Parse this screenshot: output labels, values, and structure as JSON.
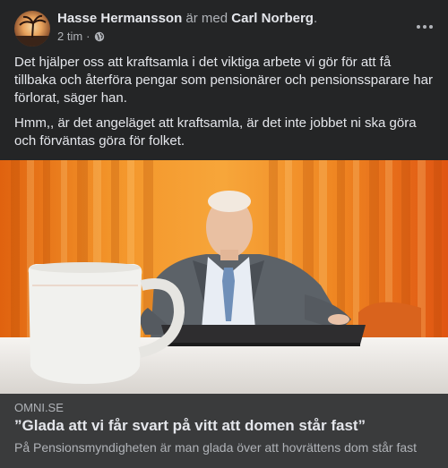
{
  "post": {
    "author": "Hasse Hermansson",
    "with_text": " är med ",
    "tagged": "Carl Norberg",
    "period": ".",
    "time": "2 tim",
    "dot": "·",
    "privacy_icon": "globe-icon",
    "more_icon": "more-horizontal-icon",
    "paragraphs": [
      "Det hjälper oss att kraftsamla i det viktiga arbete vi gör för att få tillbaka och återföra pengar som pensionärer och pensionssparare har förlorat, säger  han.",
      "Hmm,, är det angeläget att kraftsamla, är det inte jobbet ni ska göra och förväntas göra för folket."
    ]
  },
  "link": {
    "domain": "OMNI.SE",
    "title": "”Glada att vi får svart på vitt att domen står fast”",
    "description": "På Pensionsmyndigheten är man glada över att hovrättens dom står fast"
  },
  "colors": {
    "background": "#242526",
    "link_card": "#3a3b3c",
    "primary_text": "#e4e6eb",
    "secondary_text": "#b0b3b8"
  }
}
